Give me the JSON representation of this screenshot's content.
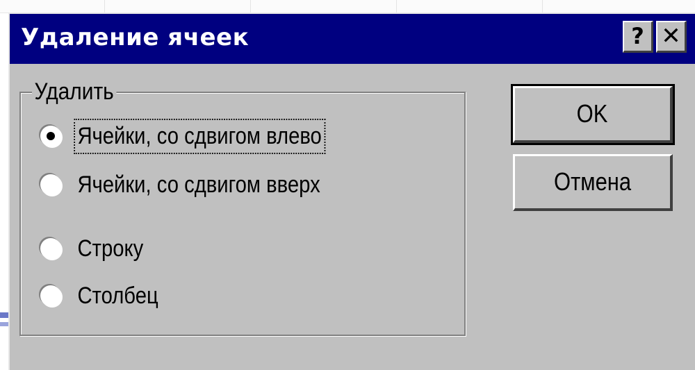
{
  "dialog": {
    "title": "Удаление ячеек",
    "help_glyph": "?",
    "close_glyph": "✕"
  },
  "group": {
    "legend": "Удалить",
    "options": [
      {
        "label": "Ячейки, со сдвигом влево",
        "checked": true
      },
      {
        "label": "Ячейки, со сдвигом вверх",
        "checked": false
      },
      {
        "label": "Строку",
        "checked": false
      },
      {
        "label": "Столбец",
        "checked": false
      }
    ]
  },
  "buttons": {
    "ok_label": "OK",
    "cancel_label": "Отмена"
  },
  "colors": {
    "titlebar": "#000080",
    "dialog_face": "#c0c0c0"
  },
  "icons": {
    "help": "help-icon",
    "close": "close-icon",
    "radio_checked": "radio-checked-icon",
    "radio_unchecked": "radio-unchecked-icon"
  }
}
